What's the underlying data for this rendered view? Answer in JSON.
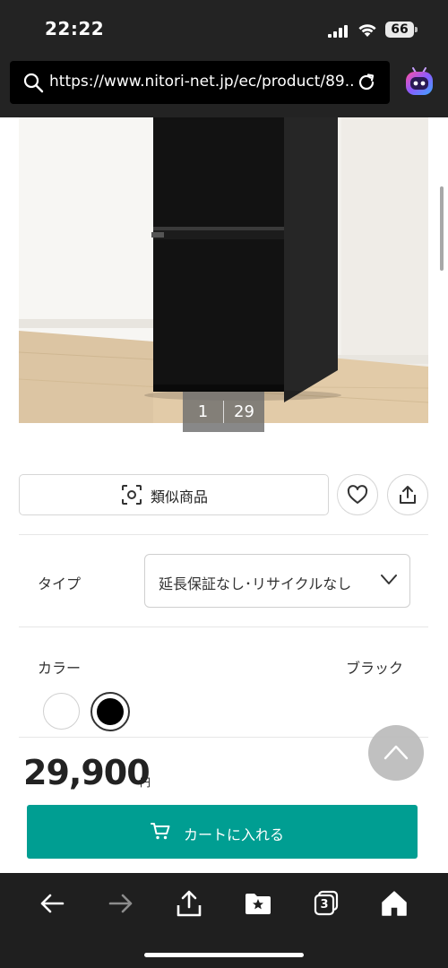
{
  "status_bar": {
    "time": "22:22",
    "battery": "66"
  },
  "browser": {
    "url": "https://www.nitori-net.jp/ec/product/89...",
    "tabs_count": "3",
    "icons": [
      "search-icon",
      "reload-icon",
      "bot-icon",
      "back-icon",
      "forward-icon",
      "share-icon",
      "bookmark-icon",
      "tabs-icon",
      "home-icon"
    ]
  },
  "gallery": {
    "current": "1",
    "total": "29"
  },
  "actions": {
    "similar_label": "類似商品"
  },
  "type_option": {
    "label": "タイプ",
    "selected": "延長保証なし･リサイクルなし"
  },
  "color_option": {
    "label": "カラー",
    "selected": "ブラック",
    "swatches": [
      "white",
      "black"
    ]
  },
  "price": {
    "amount": "29,900",
    "unit": "円"
  },
  "cart": {
    "label": "カートに入れる"
  },
  "colors": {
    "accent": "#009e92",
    "toolbar": "#1f1f1f"
  }
}
